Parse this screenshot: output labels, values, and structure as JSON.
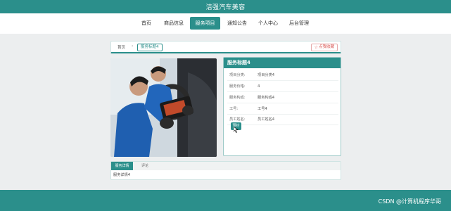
{
  "header": {
    "title": "洁强汽车美容"
  },
  "nav": {
    "items": [
      {
        "label": "首页"
      },
      {
        "label": "商品信息"
      },
      {
        "label": "服务项目"
      },
      {
        "label": "通知公告"
      },
      {
        "label": "个人中心"
      },
      {
        "label": "后台管理"
      }
    ],
    "active_index": 2
  },
  "breadcrumb": {
    "home": "首页",
    "separator": "›",
    "current": "服务标题4"
  },
  "favorite_button": {
    "label": "点我收藏",
    "icon": "star-icon"
  },
  "detail": {
    "title": "服务标题4",
    "fields": [
      {
        "key": "项目分类:",
        "value": "项目分类4"
      },
      {
        "key": "服务价格:",
        "value": "4"
      },
      {
        "key": "服务构成:",
        "value": "服务构成4"
      },
      {
        "key": "工号:",
        "value": "工号4"
      },
      {
        "key": "员工姓名:",
        "value": "员工姓名4"
      }
    ],
    "reserve_label": "预约"
  },
  "tabs": {
    "items": [
      {
        "label": "服务详情"
      },
      {
        "label": "评论"
      }
    ],
    "active_index": 0,
    "content": "服务详情4"
  },
  "footer": {
    "watermark": "CSDN @计算机程序华哥"
  },
  "colors": {
    "accent": "#2b8f8b",
    "favorite": "#d9534f"
  }
}
